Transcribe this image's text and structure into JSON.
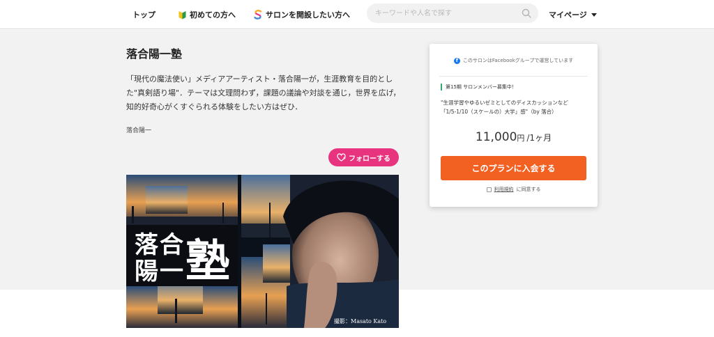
{
  "header": {
    "nav_top": "トップ",
    "nav_beginner": "初めての方へ",
    "nav_open_salon": "サロンを開設したい方へ",
    "search_placeholder": "キーワードや人名で探す",
    "nav_mypage": "マイページ"
  },
  "salon": {
    "title": "落合陽一塾",
    "description": "「現代の魔法使い」メディアアーティスト・落合陽一が，生涯教育を目的とした\"真剣語り場\"．テーマは文理問わず，課題の議論や対談を通じ，世界を広げ，知的好奇心がくすぐられる体験をしたい方はぜひ．",
    "owner": "落合陽一",
    "follow_label": "フォローする"
  },
  "hero": {
    "char_1": "落",
    "char_2": "合",
    "char_3": "陽",
    "char_4": "一",
    "char_big": "塾",
    "photo_credit": "撮影：Masato Kato"
  },
  "plan_card": {
    "facebook_note": "このサロンはFacebookグループで運営しています",
    "recruit_label": "第15期 サロンメンバー募集中！",
    "plan_line_1": "\"生涯学習やゆるいゼミとしてのディスカッションなど",
    "plan_line_2": "「1/5-1/10（スケールの）大学」感\"（by 落合）",
    "price_amount": "11,000",
    "price_currency": "円",
    "price_period": "/1ヶ月",
    "join_label": "このプランに入会する",
    "terms_link": "利用規約",
    "terms_suffix": "に同意する"
  },
  "colors": {
    "follow_pink": "#e8337e",
    "join_orange": "#f26122",
    "facebook_blue": "#1877f2",
    "recruit_green": "#2eaf6b"
  }
}
